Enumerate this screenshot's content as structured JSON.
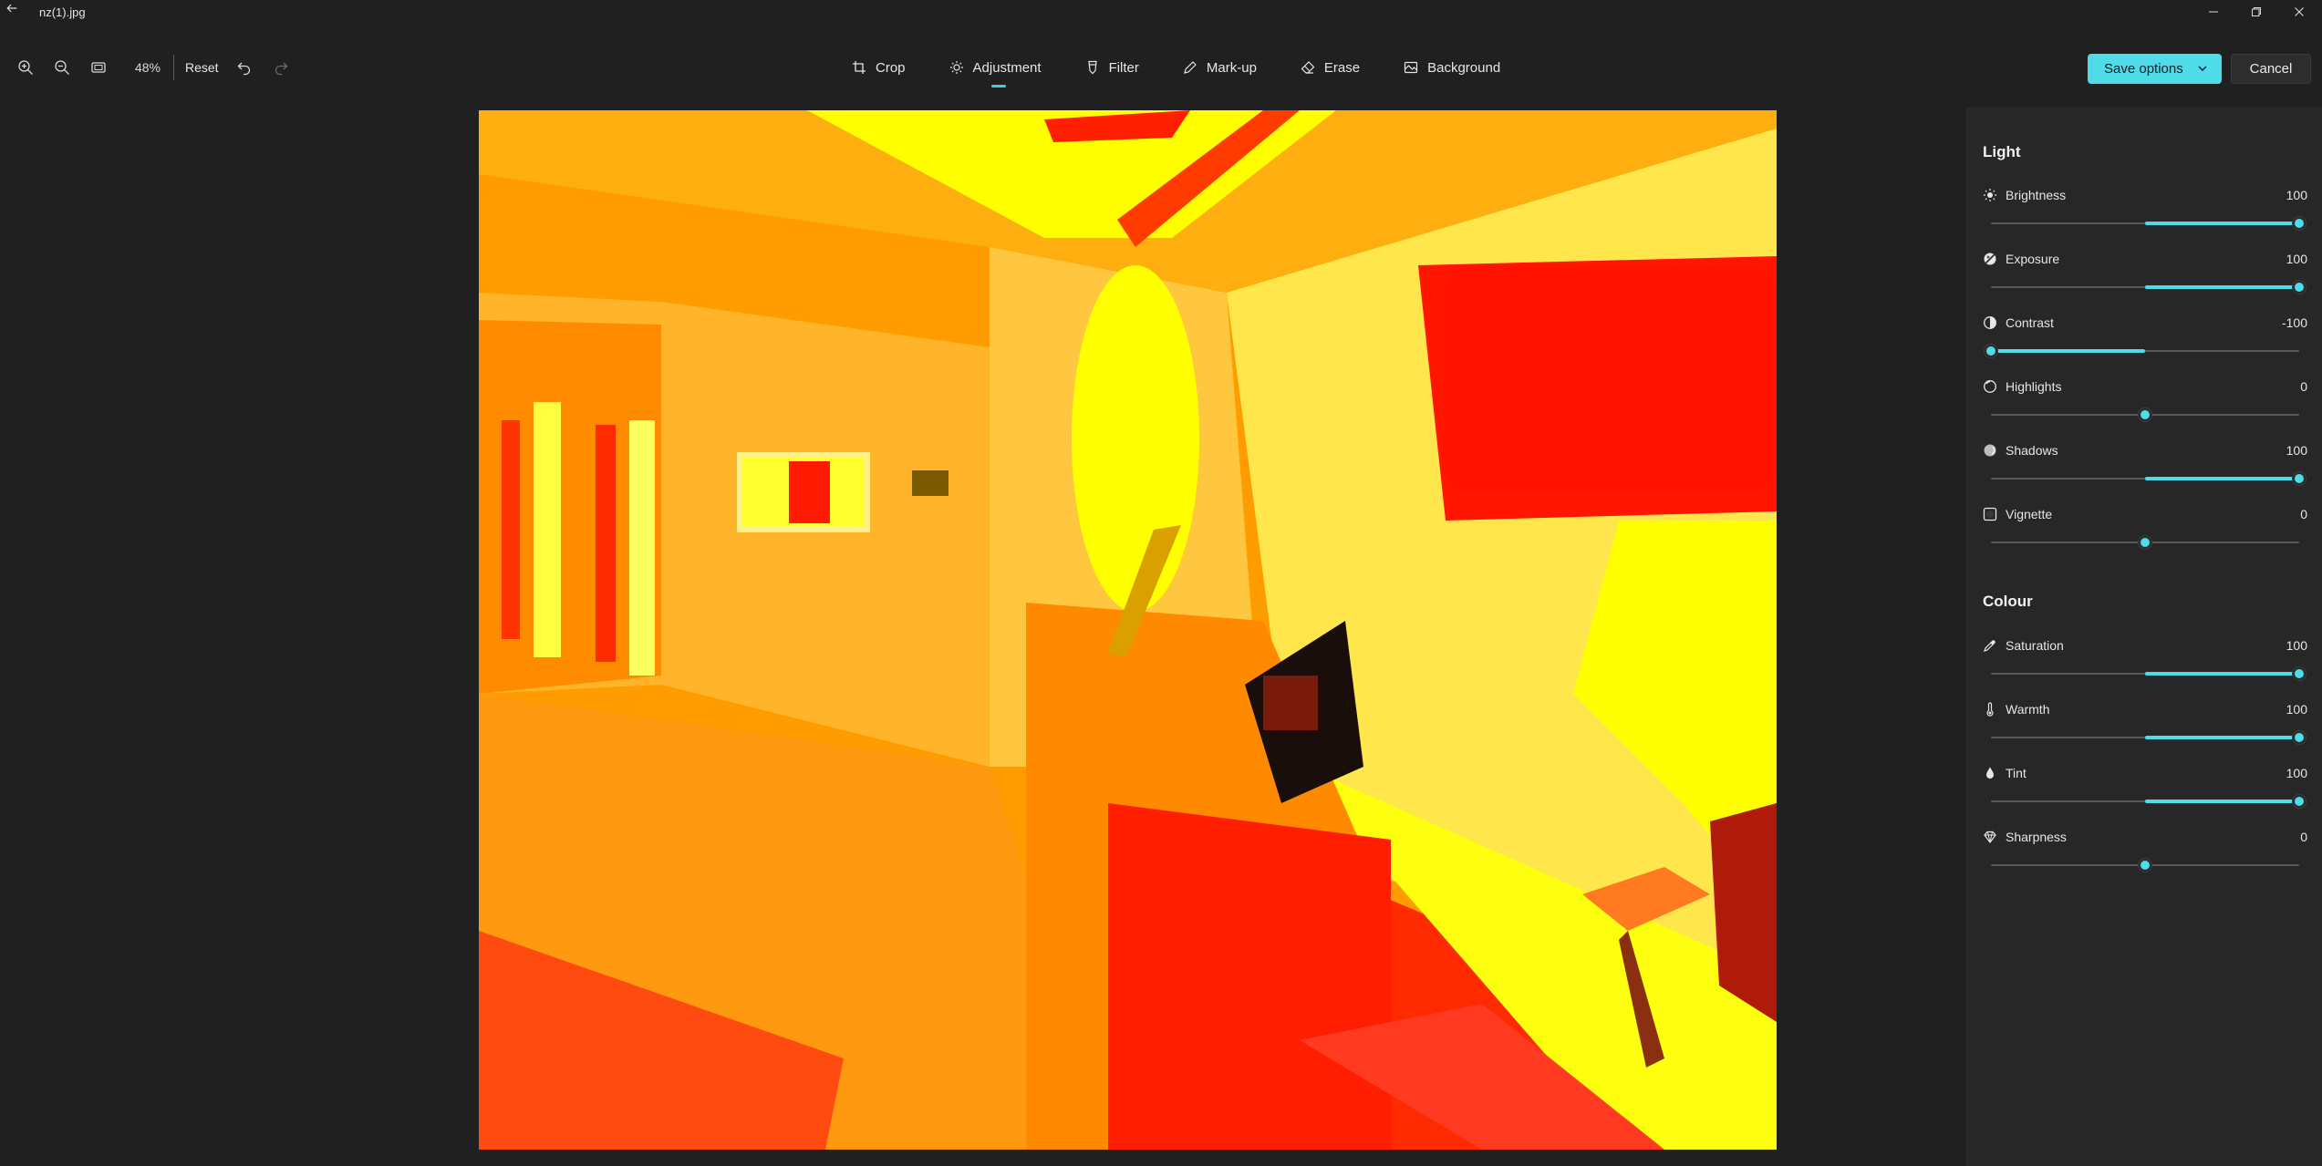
{
  "window": {
    "file_name": "nz(1).jpg"
  },
  "toolbar": {
    "zoom_level": "48%",
    "reset_label": "Reset",
    "tabs": [
      {
        "label": "Crop",
        "icon": "crop-icon"
      },
      {
        "label": "Adjustment",
        "icon": "adjustment-icon",
        "active": true
      },
      {
        "label": "Filter",
        "icon": "filter-icon"
      },
      {
        "label": "Mark-up",
        "icon": "pen-icon"
      },
      {
        "label": "Erase",
        "icon": "eraser-icon"
      },
      {
        "label": "Background",
        "icon": "background-icon"
      }
    ],
    "save_label": "Save options",
    "cancel_label": "Cancel"
  },
  "panel": {
    "light_title": "Light",
    "colour_title": "Colour",
    "light": [
      {
        "label": "Brightness",
        "value": "100",
        "level": 100
      },
      {
        "label": "Exposure",
        "value": "100",
        "level": 100
      },
      {
        "label": "Contrast",
        "value": "-100",
        "level": -100
      },
      {
        "label": "Highlights",
        "value": "0",
        "level": 0
      },
      {
        "label": "Shadows",
        "value": "100",
        "level": 100
      },
      {
        "label": "Vignette",
        "value": "0",
        "level": 0
      }
    ],
    "colour": [
      {
        "label": "Saturation",
        "value": "100",
        "level": 100
      },
      {
        "label": "Warmth",
        "value": "100",
        "level": 100
      },
      {
        "label": "Tint",
        "value": "100",
        "level": 100
      },
      {
        "label": "Sharpness",
        "value": "0",
        "level": 0
      }
    ]
  },
  "colors": {
    "accent": "#4fdbe7",
    "background": "#202020",
    "panel": "#272727"
  }
}
